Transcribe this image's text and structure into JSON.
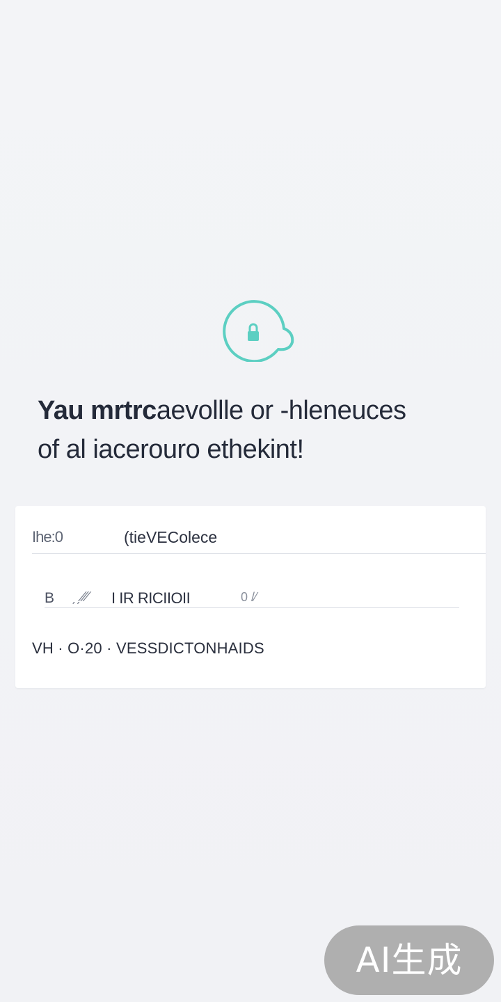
{
  "badge": {
    "icon": "lock-icon",
    "accent_color": "#5ccfc2"
  },
  "headline": {
    "bold": "Yau mrtrc",
    "line1_rest": "aevollle or -hleneuces",
    "line2": "of al iacerouro ethekint!"
  },
  "card": {
    "row1": {
      "label": "Ihe:0",
      "value": "(tieVEColece"
    },
    "row2": {
      "icon": "B",
      "mark": "ˏˏ∕⁄∕",
      "text": "I IR RICIIOII",
      "tag": "0 /⁄"
    },
    "row3": {
      "text": "VH · O·20 · VESSDICTONHAIDS"
    }
  },
  "watermark": {
    "text": "AI生成"
  }
}
